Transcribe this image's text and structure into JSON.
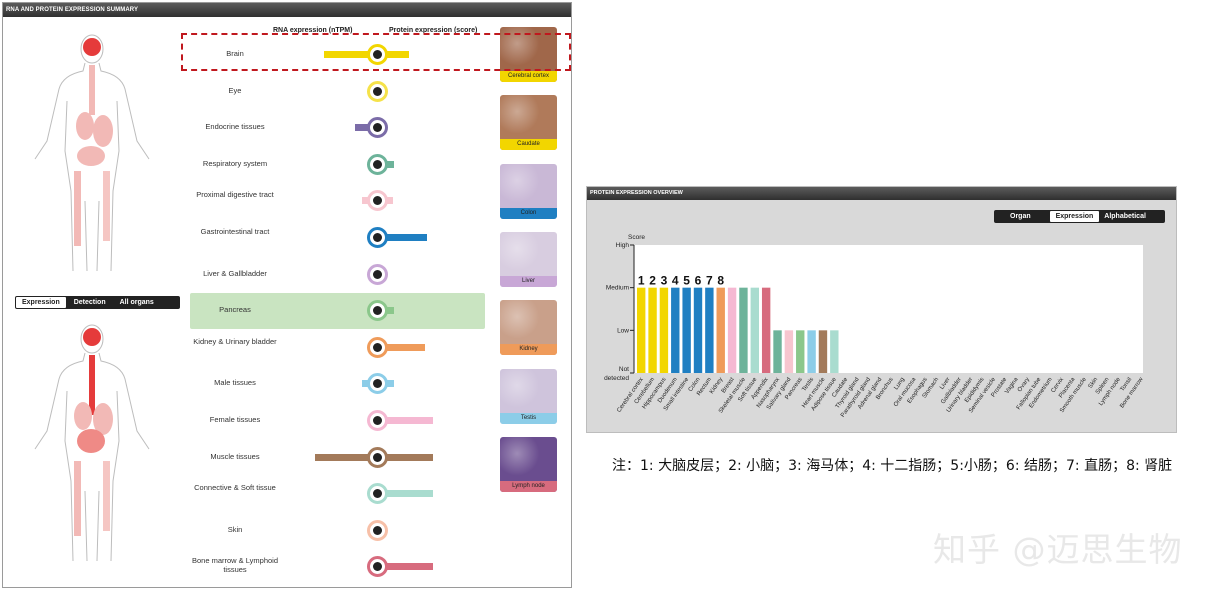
{
  "summary_panel": {
    "title": "RNA AND PROTEIN EXPRESSION SUMMARY",
    "rna_header": "RNA expression (nTPM)",
    "protein_header": "Protein expression (score)",
    "toggle": {
      "options": [
        "Expression",
        "Detection",
        "All organs"
      ],
      "active": "Expression"
    },
    "rows": [
      {
        "label": "Brain",
        "rna": 0.85,
        "protein": 0.52,
        "color": "#f2d600",
        "highlight": false
      },
      {
        "label": "Eye",
        "rna": 0.15,
        "protein": 0.0,
        "color": "#f5e24a",
        "highlight": false
      },
      {
        "label": "Endocrine tissues",
        "rna": 0.35,
        "protein": 0.0,
        "color": "#7b6ca8",
        "highlight": false
      },
      {
        "label": "Respiratory system",
        "rna": 0.0,
        "protein": 0.28,
        "color": "#6db39a",
        "highlight": false
      },
      {
        "label": "Proximal digestive tract",
        "rna": 0.25,
        "protein": 0.25,
        "color": "#f7c6cf",
        "highlight": false
      },
      {
        "label": "Gastrointestinal tract",
        "rna": 0.1,
        "protein": 0.8,
        "color": "#1f7fc2",
        "highlight": false
      },
      {
        "label": "Liver & Gallbladder",
        "rna": 0.0,
        "protein": 0.0,
        "color": "#c8a7d6",
        "highlight": false
      },
      {
        "label": "Pancreas",
        "rna": 0.0,
        "protein": 0.28,
        "color": "#8bc78b",
        "highlight": true
      },
      {
        "label": "Kidney & Urinary bladder",
        "rna": 0.15,
        "protein": 0.78,
        "color": "#ef9b5a",
        "highlight": false
      },
      {
        "label": "Male tissues",
        "rna": 0.25,
        "protein": 0.28,
        "color": "#8ccde8",
        "highlight": false
      },
      {
        "label": "Female tissues",
        "rna": 0.1,
        "protein": 0.9,
        "color": "#f5b8d2",
        "highlight": false
      },
      {
        "label": "Muscle tissues",
        "rna": 1.0,
        "protein": 0.9,
        "color": "#a37a5a",
        "highlight": false
      },
      {
        "label": "Connective & Soft tissue",
        "rna": 0.1,
        "protein": 0.9,
        "color": "#a9dccf",
        "highlight": false
      },
      {
        "label": "Skin",
        "rna": 0.1,
        "protein": 0.0,
        "color": "#f7c0a8",
        "highlight": false
      },
      {
        "label": "Bone marrow & Lymphoid tissues",
        "rna": 0.1,
        "protein": 0.9,
        "color": "#d76b7e",
        "highlight": false
      }
    ],
    "thumbnails": [
      {
        "label": "Cerebral cortex",
        "color": "#f2d600",
        "bg": "#a0674a"
      },
      {
        "label": "Caudate",
        "color": "#f2d600",
        "bg": "#b07a5a"
      },
      {
        "label": "Colon",
        "color": "#1f7fc2",
        "bg": "#c9b8d6"
      },
      {
        "label": "Liver",
        "color": "#c8a7d6",
        "bg": "#d8cde0"
      },
      {
        "label": "Kidney",
        "color": "#ef9b5a",
        "bg": "#c9a08a"
      },
      {
        "label": "Testis",
        "color": "#8ccde8",
        "bg": "#cfc4dc"
      },
      {
        "label": "Lymph node",
        "color": "#d76b7e",
        "bg": "#6a4d8f"
      }
    ]
  },
  "overview_panel": {
    "title": "PROTEIN EXPRESSION OVERVIEW",
    "toggle": {
      "options": [
        "Organ",
        "Expression",
        "Alphabetical"
      ],
      "active": "Expression"
    }
  },
  "chart_data": {
    "type": "bar",
    "ylabel": "Score",
    "y_levels": [
      "Not detected",
      "Low",
      "Medium",
      "High"
    ],
    "categories": [
      "Cerebral cortex",
      "Cerebellum",
      "Hippocampus",
      "Duodenum",
      "Small intestine",
      "Colon",
      "Rectum",
      "Kidney",
      "Breast",
      "Skeletal muscle",
      "Soft tissue",
      "Appendix",
      "Nasopharynx",
      "Salivary gland",
      "Pancreas",
      "Testis",
      "Heart muscle",
      "Adipose tissue",
      "Caudate",
      "Thyroid gland",
      "Parathyroid gland",
      "Adrenal gland",
      "Bronchus",
      "Lung",
      "Oral mucosa",
      "Esophagus",
      "Stomach",
      "Liver",
      "Gallbladder",
      "Urinary bladder",
      "Epididymis",
      "Seminal vesicle",
      "Prostate",
      "Vagina",
      "Ovary",
      "Fallopian tube",
      "Endometrium",
      "Cervix",
      "Placenta",
      "Smooth muscle",
      "Skin",
      "Spleen",
      "Lymph node",
      "Tonsil",
      "Bone marrow"
    ],
    "values": [
      2,
      2,
      2,
      2,
      2,
      2,
      2,
      2,
      2,
      2,
      2,
      2,
      1,
      1,
      1,
      1,
      1,
      1,
      0,
      0,
      0,
      0,
      0,
      0,
      0,
      0,
      0,
      0,
      0,
      0,
      0,
      0,
      0,
      0,
      0,
      0,
      0,
      0,
      0,
      0,
      0,
      0,
      0,
      0,
      0
    ],
    "colors": [
      "#f2d600",
      "#f2d600",
      "#f2d600",
      "#1f7fc2",
      "#1f7fc2",
      "#1f7fc2",
      "#1f7fc2",
      "#ef9b5a",
      "#f5b8d2",
      "#6db39a",
      "#a9dccf",
      "#d76b7e",
      "#6db39a",
      "#f7c6cf",
      "#8bc78b",
      "#8ccde8",
      "#a37a5a",
      "#a9dccf",
      "#f2d600",
      "#7b6ca8",
      "#7b6ca8",
      "#7b6ca8",
      "#6db39a",
      "#6db39a",
      "#f7c6cf",
      "#f7c6cf",
      "#1f7fc2",
      "#c8a7d6",
      "#c8a7d6",
      "#ef9b5a",
      "#8ccde8",
      "#8ccde8",
      "#8ccde8",
      "#f5b8d2",
      "#f5b8d2",
      "#f5b8d2",
      "#f5b8d2",
      "#f5b8d2",
      "#f5b8d2",
      "#a37a5a",
      "#f7c0a8",
      "#d76b7e",
      "#d76b7e",
      "#d76b7e",
      "#d76b7e"
    ],
    "bar_numbers": [
      "1",
      "2",
      "3",
      "4",
      "5",
      "6",
      "7",
      "8"
    ]
  },
  "note": "注：1: 大脑皮层；2: 小脑；3: 海马体；4: 十二指肠；5:小肠；6: 结肠；7: 直肠；8: 肾脏",
  "watermark": "知乎 @迈思生物"
}
